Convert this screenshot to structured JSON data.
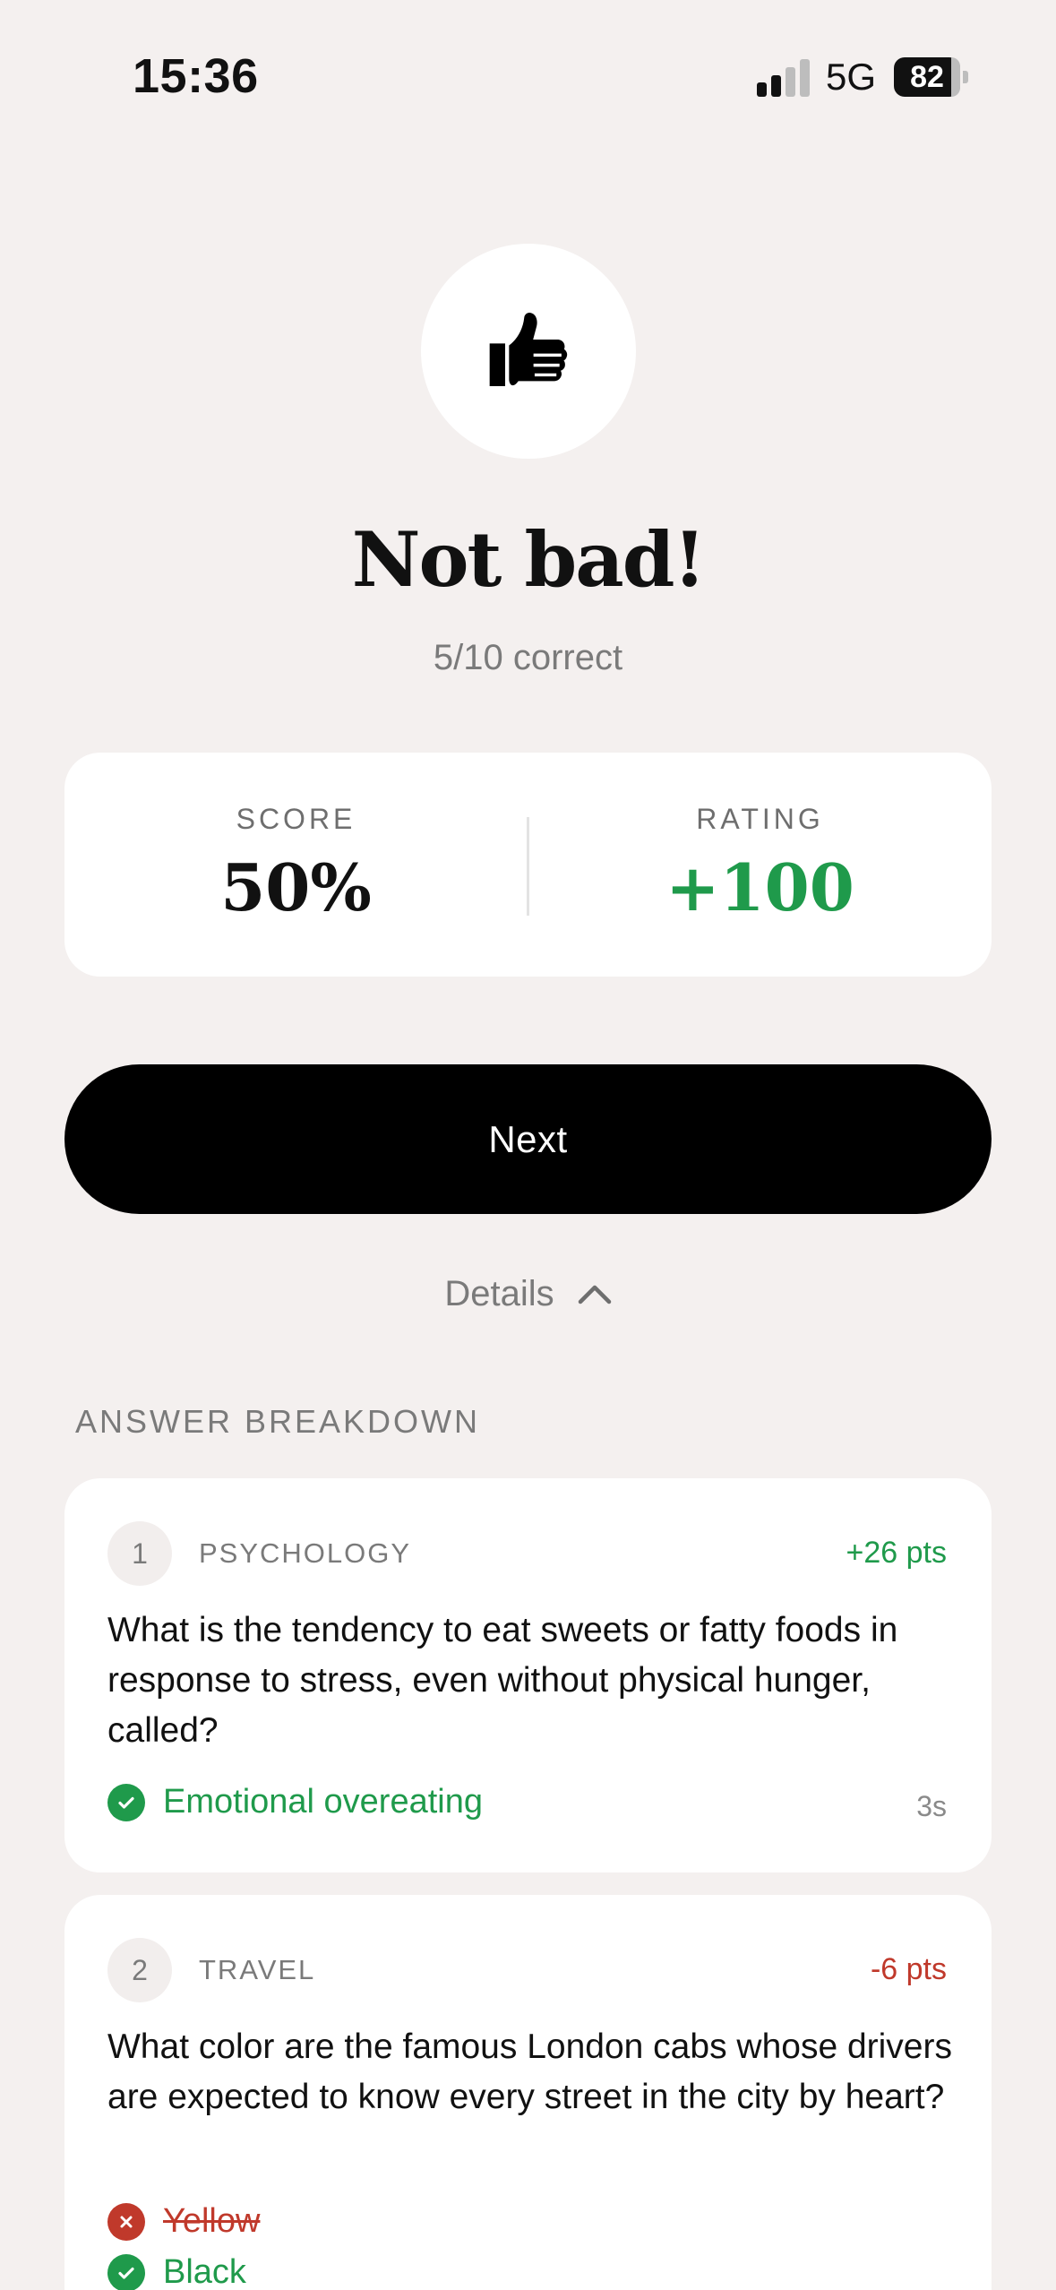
{
  "status_bar": {
    "time": "15:36",
    "network": "5G",
    "battery": "82"
  },
  "hero": {
    "icon": "thumbs-up-icon",
    "title": "Not bad!",
    "subtitle": "5/10 correct"
  },
  "stats": {
    "score_label": "SCORE",
    "score_value": "50%",
    "rating_label": "RATING",
    "rating_value": "+100"
  },
  "next_button": {
    "label": "Next"
  },
  "details": {
    "label": "Details",
    "icon": "chevron-up-icon"
  },
  "breakdown": {
    "title": "ANSWER BREAKDOWN",
    "items": [
      {
        "number": "1",
        "category": "PSYCHOLOGY",
        "points": "+26 pts",
        "question": "What is the tendency to eat sweets or fatty foods in response to stress, even without physical hunger, called?",
        "answers": [
          {
            "text": "Emotional overeating",
            "status": "correct"
          }
        ],
        "time": "3s"
      },
      {
        "number": "2",
        "category": "TRAVEL",
        "points": "-6 pts",
        "question": "What color are the famous London cabs whose drivers are expected to know every street in the city by heart?",
        "answers": [
          {
            "text": "Yellow",
            "status": "wrong"
          },
          {
            "text": "Black",
            "status": "correct"
          }
        ]
      }
    ]
  },
  "colors": {
    "background": "#f4f0ef",
    "green": "#1f9a4b",
    "red": "#c0392b",
    "button": "#000000"
  }
}
